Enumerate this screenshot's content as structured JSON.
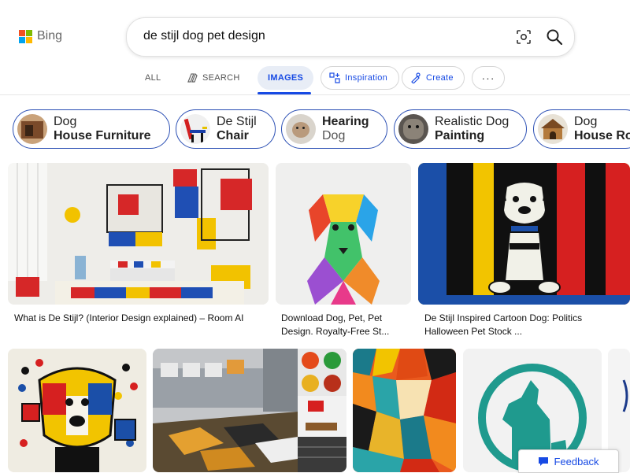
{
  "brand": {
    "name": "Bing",
    "logo_colors": [
      "#f25022",
      "#7fba00",
      "#00a4ef",
      "#ffb900"
    ]
  },
  "search": {
    "query": "de stijl dog pet design"
  },
  "tabs": {
    "all": "ALL",
    "search": "SEARCH",
    "images": "IMAGES",
    "inspiration": "Inspiration",
    "create": "Create",
    "more": "···"
  },
  "related": [
    {
      "l1": "Dog",
      "l2": "House Furniture"
    },
    {
      "l1": "De Stijl",
      "l2": "Chair"
    },
    {
      "l1": "Hearing",
      "l2": "Dog"
    },
    {
      "l1": "Realistic Dog",
      "l2": "Painting"
    },
    {
      "l1": "Dog",
      "l2": "House Ro"
    }
  ],
  "results": [
    {
      "caption": "What is De Stijl? (Interior Design explained) – Room AI"
    },
    {
      "caption_l1": "Download Dog, Pet, Pet",
      "caption_l2": "Design. Royalty-Free St..."
    },
    {
      "caption_l1": "De Stijl Inspired Cartoon Dog: Politics",
      "caption_l2": "Halloween Pet Stock ..."
    }
  ],
  "feedback": "Feedback",
  "colors": {
    "accent": "#174ae4",
    "chip_border": "#2b4fb4"
  }
}
